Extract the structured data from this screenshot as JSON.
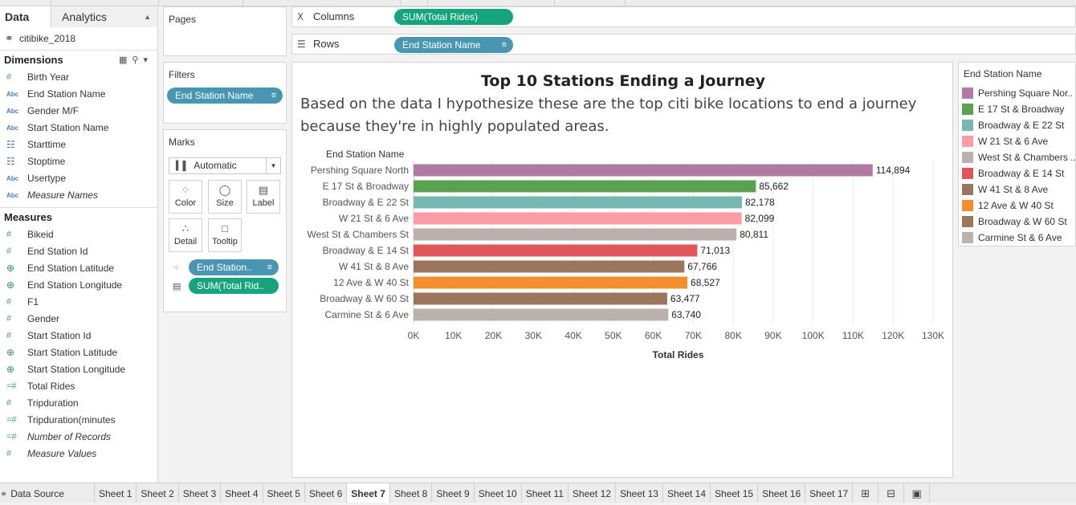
{
  "left_pane": {
    "tab_data": "Data",
    "tab_analytics": "Analytics",
    "datasource": "citibike_2018",
    "dimensions_title": "Dimensions",
    "dimensions": [
      {
        "label": "Birth Year",
        "type": "num",
        "italic": false
      },
      {
        "label": "End Station Name",
        "type": "abc",
        "italic": false
      },
      {
        "label": "Gender M/F",
        "type": "abc",
        "italic": false
      },
      {
        "label": "Start Station Name",
        "type": "abc",
        "italic": false
      },
      {
        "label": "Starttime",
        "type": "cal",
        "italic": false
      },
      {
        "label": "Stoptime",
        "type": "cal",
        "italic": false
      },
      {
        "label": "Usertype",
        "type": "abc",
        "italic": false
      },
      {
        "label": "Measure Names",
        "type": "abc",
        "italic": true
      }
    ],
    "measures_title": "Measures",
    "measures": [
      {
        "label": "Bikeid",
        "type": "num",
        "italic": false
      },
      {
        "label": "End Station Id",
        "type": "num",
        "italic": false
      },
      {
        "label": "End Station Latitude",
        "type": "geo",
        "italic": false
      },
      {
        "label": "End Station Longitude",
        "type": "geo",
        "italic": false
      },
      {
        "label": "F1",
        "type": "num",
        "italic": false
      },
      {
        "label": "Gender",
        "type": "num",
        "italic": false
      },
      {
        "label": "Start Station Id",
        "type": "num",
        "italic": false
      },
      {
        "label": "Start Station Latitude",
        "type": "geo",
        "italic": false
      },
      {
        "label": "Start Station Longitude",
        "type": "geo",
        "italic": false
      },
      {
        "label": "Total Rides",
        "type": "calc",
        "italic": false
      },
      {
        "label": "Tripduration",
        "type": "num",
        "italic": false
      },
      {
        "label": "Tripduration(minutes",
        "type": "calc",
        "italic": false
      },
      {
        "label": "Number of Records",
        "type": "calc",
        "italic": true
      },
      {
        "label": "Measure Values",
        "type": "num",
        "italic": true
      }
    ]
  },
  "pages": {
    "title": "Pages"
  },
  "filters": {
    "title": "Filters",
    "pill": "End Station Name"
  },
  "marks": {
    "title": "Marks",
    "type": "Automatic",
    "buttons": {
      "color": "Color",
      "size": "Size",
      "label": "Label",
      "detail": "Detail",
      "tooltip": "Tooltip"
    },
    "pill_color": "End Station..",
    "pill_label": "SUM(Total Rid.."
  },
  "shelves": {
    "columns_label": "Columns",
    "columns_pill": "SUM(Total Rides)",
    "rows_label": "Rows",
    "rows_pill": "End Station Name"
  },
  "viz": {
    "title": "Top 10 Stations Ending a Journey",
    "subtitle": "Based on the data I hypothesize these are the top citi bike locations to end a journey because they're in highly populated areas."
  },
  "chart_data": {
    "type": "bar",
    "orientation": "horizontal",
    "row_header": "End Station Name",
    "xlabel": "Total Rides",
    "xlim": [
      0,
      130000
    ],
    "x_ticks": [
      "0K",
      "10K",
      "20K",
      "30K",
      "40K",
      "50K",
      "60K",
      "70K",
      "80K",
      "90K",
      "100K",
      "110K",
      "120K",
      "130K"
    ],
    "grid": true,
    "categories": [
      "Pershing Square North",
      "E 17 St & Broadway",
      "Broadway & E 22 St",
      "W 21 St & 6 Ave",
      "West St & Chambers St",
      "Broadway & E 14 St",
      "W 41 St & 8 Ave",
      "12 Ave & W 40 St",
      "Broadway & W 60 St",
      "Carmine St & 6 Ave"
    ],
    "values": [
      114894,
      85662,
      82178,
      82099,
      80811,
      71013,
      67766,
      68527,
      63477,
      63740
    ],
    "value_labels": [
      "114,894",
      "85,662",
      "82,178",
      "82,099",
      "80,811",
      "71,013",
      "67,766",
      "68,527",
      "63,477",
      "63,740"
    ],
    "colors": [
      "#b07aa1",
      "#59a14f",
      "#76b7b2",
      "#ff9da7",
      "#bab0ac",
      "#e15759",
      "#9c755f",
      "#f28e2b",
      "#9c755f",
      "#bab0ac"
    ]
  },
  "legend": {
    "title": "End Station Name",
    "items": [
      {
        "label": "Pershing Square Nor..",
        "color": "#b07aa1"
      },
      {
        "label": "E 17 St & Broadway",
        "color": "#59a14f"
      },
      {
        "label": "Broadway & E 22 St",
        "color": "#76b7b2"
      },
      {
        "label": "W 21 St & 6 Ave",
        "color": "#ff9da7"
      },
      {
        "label": "West St & Chambers ..",
        "color": "#bab0ac"
      },
      {
        "label": "Broadway & E 14 St",
        "color": "#e15759"
      },
      {
        "label": "W 41 St & 8 Ave",
        "color": "#9c755f"
      },
      {
        "label": "12 Ave & W 40 St",
        "color": "#f28e2b"
      },
      {
        "label": "Broadway & W 60 St",
        "color": "#9c755f"
      },
      {
        "label": "Carmine St & 6 Ave",
        "color": "#bab0ac"
      }
    ]
  },
  "bottom_tabs": {
    "data_source": "Data Source",
    "sheets": [
      "Sheet 1",
      "Sheet 2",
      "Sheet 3",
      "Sheet 4",
      "Sheet 5",
      "Sheet 6",
      "Sheet 7",
      "Sheet 8",
      "Sheet 9",
      "Sheet 10",
      "Sheet 11",
      "Sheet 12",
      "Sheet 13",
      "Sheet 14",
      "Sheet 15",
      "Sheet 16",
      "Sheet 17"
    ],
    "active": "Sheet 7"
  }
}
